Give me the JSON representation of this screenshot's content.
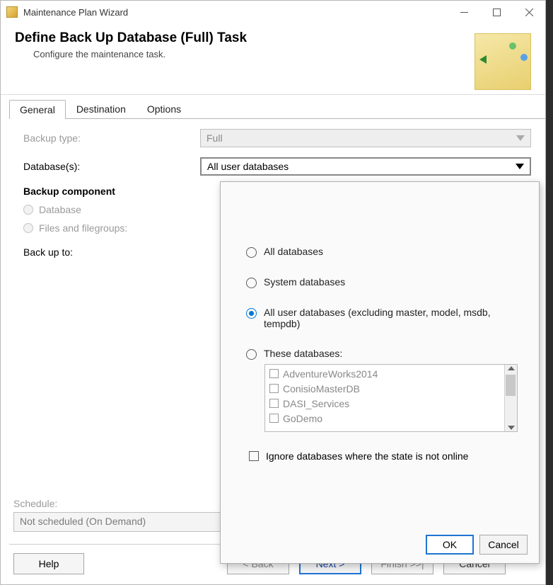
{
  "window": {
    "title": "Maintenance Plan Wizard"
  },
  "header": {
    "title": "Define Back Up Database (Full) Task",
    "subtitle": "Configure the maintenance task."
  },
  "tabs": [
    "General",
    "Destination",
    "Options"
  ],
  "form": {
    "backup_type_label": "Backup type:",
    "backup_type_value": "Full",
    "databases_label": "Database(s):",
    "databases_value": "All user databases",
    "backup_component_label": "Backup component",
    "component_radio": {
      "database": "Database",
      "files_filegroups": "Files and filegroups:"
    },
    "backup_to_label": "Back up to:"
  },
  "schedule": {
    "label": "Schedule:",
    "value": "Not scheduled (On Demand)"
  },
  "footer": {
    "help": "Help",
    "back": "< Back",
    "next": "Next >",
    "finish": "Finish >>|",
    "cancel": "Cancel"
  },
  "popup": {
    "options": {
      "all_db": "All databases",
      "system_db": "System databases",
      "all_user_db": "All user databases  (excluding master, model, msdb, tempdb)",
      "these_db": "These databases:"
    },
    "db_list": [
      "AdventureWorks2014",
      "ConisioMasterDB",
      "DASI_Services",
      "GoDemo"
    ],
    "ignore_label": "Ignore databases where the state is not online",
    "ok": "OK",
    "cancel": "Cancel"
  }
}
